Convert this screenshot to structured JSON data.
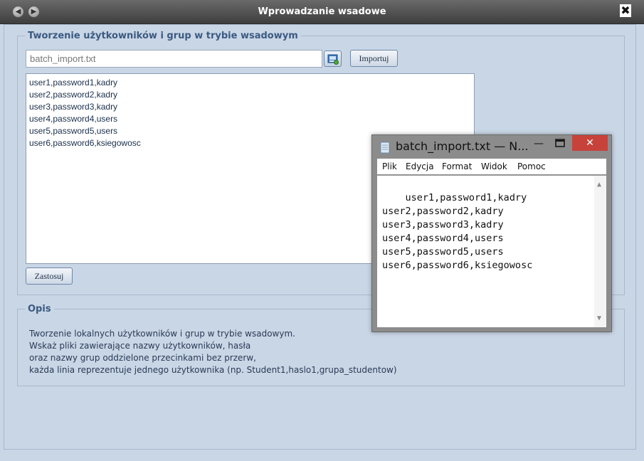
{
  "window": {
    "title": "Wprowadzanie wsadowe",
    "back_glyph": "◀",
    "forward_glyph": "▶",
    "close_glyph": "✖"
  },
  "batch_section": {
    "legend": "Tworzenie użytkowników i grup w trybie wsadowym",
    "file_input_value": "batch_import.txt",
    "import_label": "Importuj",
    "apply_label": "Zastosuj",
    "content": "user1,password1,kadry\nuser2,password2,kadry\nuser3,password3,kadry\nuser4,password4,users\nuser5,password5,users\nuser6,password6,ksiegowosc"
  },
  "description_section": {
    "legend": "Opis",
    "lines": [
      "Tworzenie lokalnych użytkowników i grup w trybie wsadowym.",
      "Wskaż pliki zawierające nazwy użytkowników, hasła",
      "oraz nazwy grup oddzielone przecinkami bez przerw,",
      "każda linia reprezentuje jednego użytkownika (np. Student1,haslo1,grupa_studentow)"
    ]
  },
  "notepad": {
    "title": "batch_import.txt — N...",
    "min_glyph": "—",
    "close_glyph": "✕",
    "menu": [
      "Plik",
      "Edycja",
      "Format",
      "Widok",
      "Pomoc"
    ],
    "content": "user1,password1,kadry\nuser2,password2,kadry\nuser3,password3,kadry\nuser4,password4,users\nuser5,password5,users\nuser6,password6,ksiegowosc",
    "scroll_up_glyph": "▲",
    "scroll_down_glyph": "▼"
  },
  "icons": {
    "browse": "browse-file-icon",
    "notepad": "notepad-icon"
  }
}
